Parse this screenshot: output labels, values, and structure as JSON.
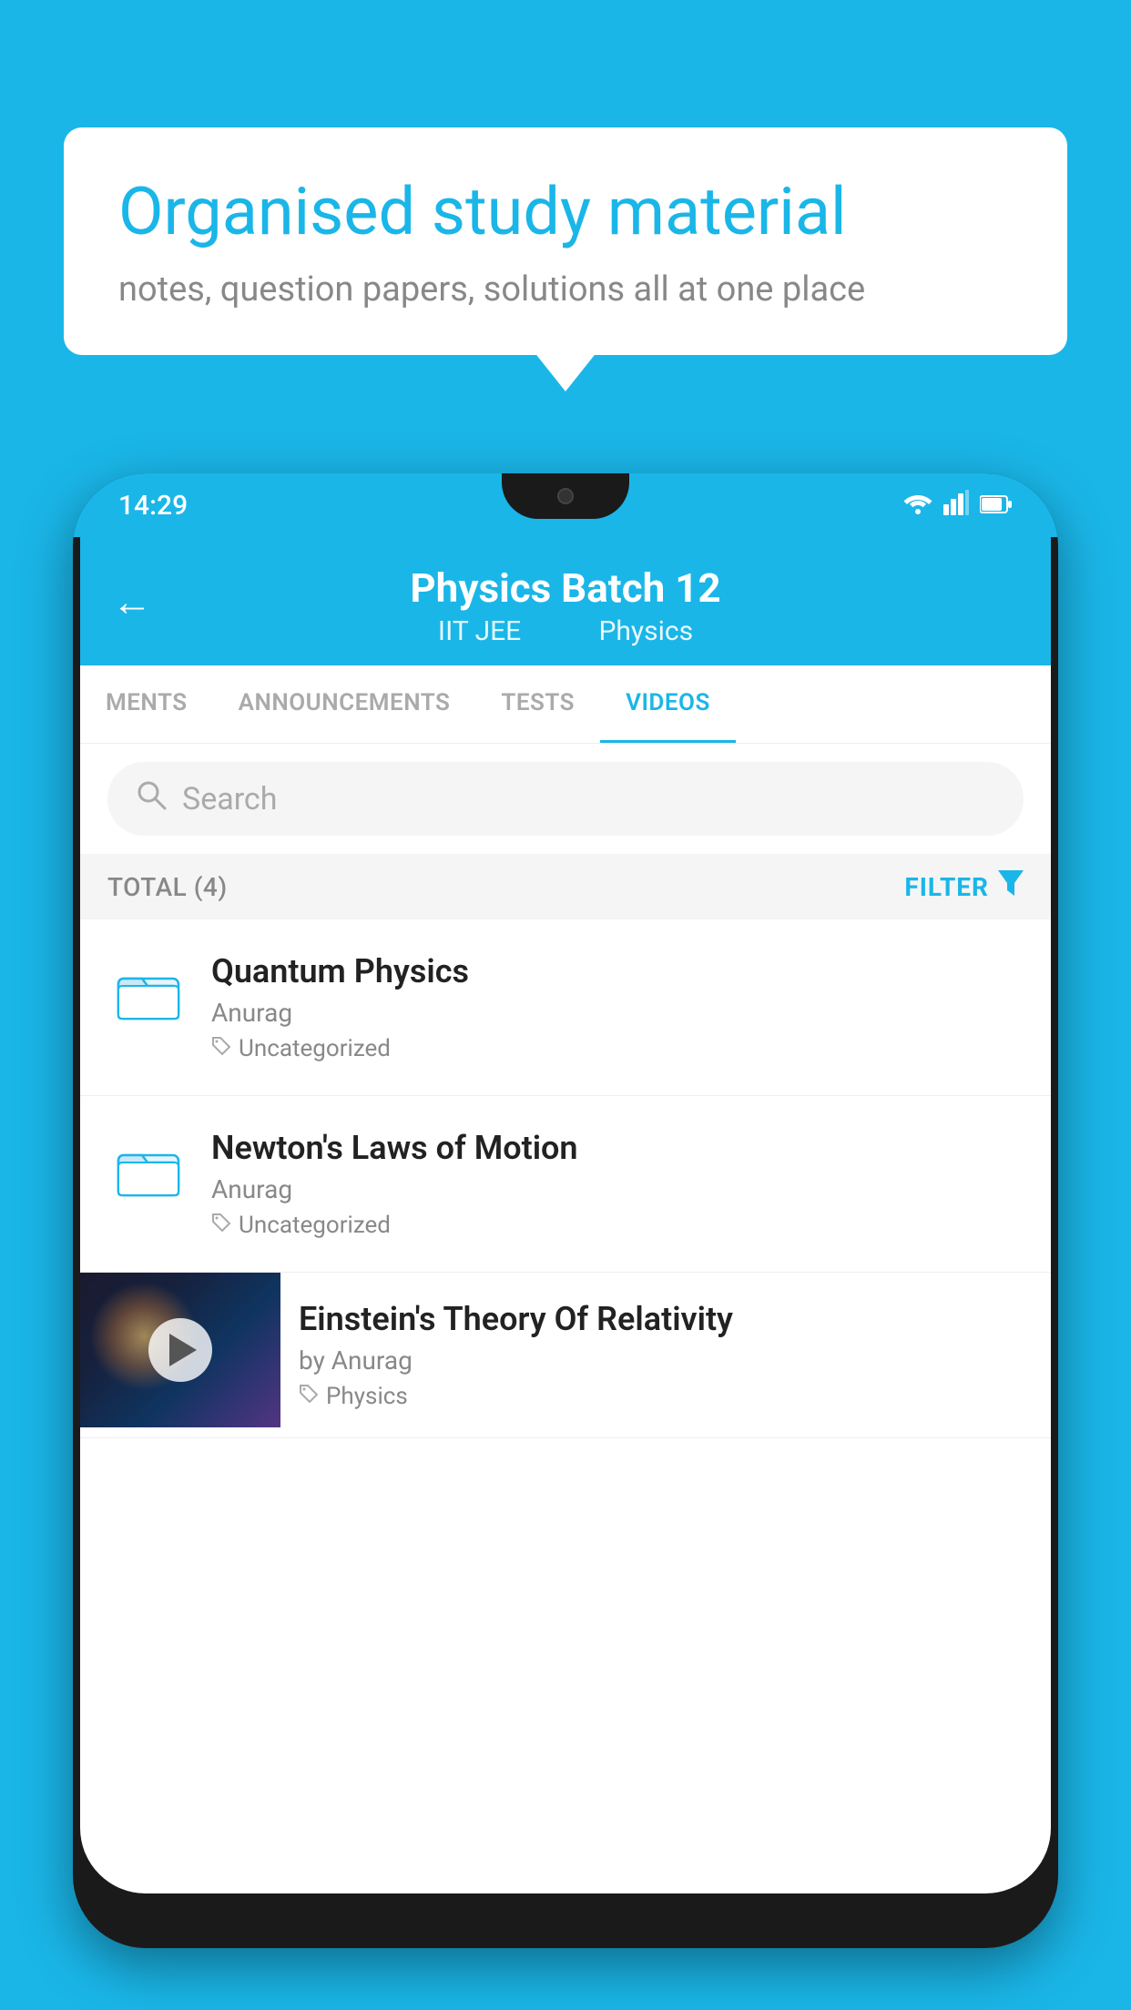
{
  "background": {
    "color": "#1ab6e8"
  },
  "speech_bubble": {
    "title": "Organised study material",
    "subtitle": "notes, question papers, solutions all at one place"
  },
  "status_bar": {
    "time": "14:29",
    "icons": [
      "wifi",
      "signal",
      "battery"
    ]
  },
  "app_header": {
    "back_label": "←",
    "title": "Physics Batch 12",
    "subtitle_part1": "IIT JEE",
    "subtitle_part2": "Physics"
  },
  "tabs": [
    {
      "label": "MENTS",
      "active": false
    },
    {
      "label": "ANNOUNCEMENTS",
      "active": false
    },
    {
      "label": "TESTS",
      "active": false
    },
    {
      "label": "VIDEOS",
      "active": true
    }
  ],
  "search": {
    "placeholder": "Search"
  },
  "filter_row": {
    "total_label": "TOTAL (4)",
    "filter_label": "FILTER"
  },
  "videos": [
    {
      "id": 1,
      "title": "Quantum Physics",
      "author": "Anurag",
      "tag": "Uncategorized",
      "has_thumbnail": false
    },
    {
      "id": 2,
      "title": "Newton's Laws of Motion",
      "author": "Anurag",
      "tag": "Uncategorized",
      "has_thumbnail": false
    },
    {
      "id": 3,
      "title": "Einstein's Theory Of Relativity",
      "author": "by Anurag",
      "tag": "Physics",
      "has_thumbnail": true
    }
  ]
}
